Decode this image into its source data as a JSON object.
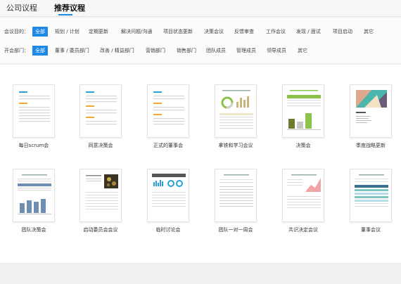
{
  "tabs": [
    {
      "label": "公司议程"
    },
    {
      "label": "推荐议程"
    }
  ],
  "filters": {
    "purpose": {
      "label": "会议目的：",
      "options": [
        "全部",
        "规划 / 计划",
        "定期更新",
        "解决问题/沟通",
        "项目状态更新",
        "决策会议",
        "反馈审查",
        "工作会议",
        "发现 / 面试",
        "项目启动",
        "其它"
      ],
      "active_index": 0
    },
    "department": {
      "label": "开会部门：",
      "options": [
        "全部",
        "董事 / 委员部门",
        "改善 / 精益部门",
        "营销部门",
        "销售部门",
        "团队成员",
        "管理成员",
        "领导成员",
        "其它"
      ],
      "active_index": 0
    }
  },
  "templates": [
    {
      "name": "每日scrum会"
    },
    {
      "name": "同意决策会"
    },
    {
      "name": "正式的董事会"
    },
    {
      "name": "拿铁和学习会议"
    },
    {
      "name": "决策会"
    },
    {
      "name": "季度战略更新"
    },
    {
      "name": "团队决策会"
    },
    {
      "name": "启动委员会会议"
    },
    {
      "name": "临时讨论会"
    },
    {
      "name": "团队一对一周会"
    },
    {
      "name": "共识决定会议"
    },
    {
      "name": "董事会议"
    }
  ],
  "colors": {
    "accent": "#1e88e5",
    "highlight_blue": "#29a0d8",
    "highlight_orange": "#f0a830",
    "teal": "#4db6ac"
  }
}
